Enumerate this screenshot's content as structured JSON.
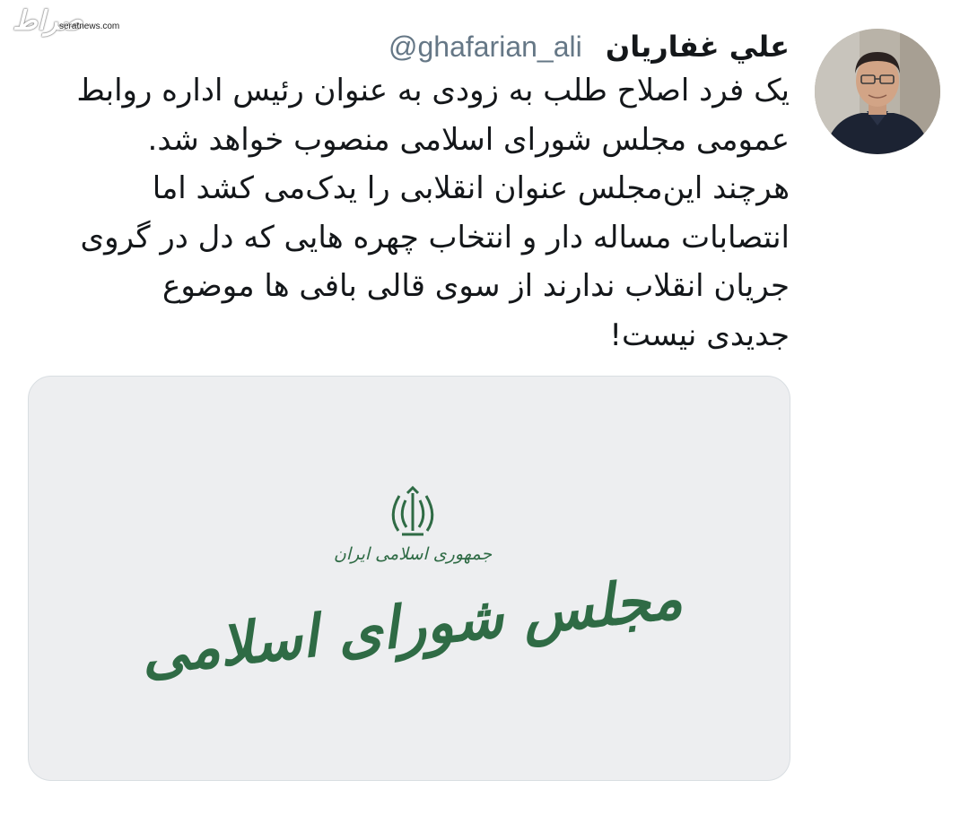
{
  "watermark": {
    "logo": "صراط",
    "site": "seratnews.com"
  },
  "tweet": {
    "author": {
      "display_name": "علي غفاريان",
      "handle": "@ghafarian_ali"
    },
    "text_lines": [
      "یک فرد اصلاح طلب به زودی به عنوان رئیس اداره روابط",
      "عمومی مجلس شورای اسلامی منصوب خواهد شد.",
      "هرچند این‌مجلس عنوان انقلابی را یدک‌می کشد اما",
      "انتصابات مساله دار و انتخاب چهره هایی که دل در گروی",
      "جریان انقلاب ندارند از سوی قالی بافی ها موضوع",
      "جدیدی نیست!"
    ],
    "media": {
      "subtitle": "جمهوری اسلامی ایران",
      "title": "مجلس شورای اسلامی"
    }
  },
  "colors": {
    "text": "#14171a",
    "secondary_text": "#657786",
    "card_background": "#edeef0",
    "card_border": "#d9dee2",
    "logo_green": "#2f6b45"
  },
  "icons": {
    "emblem": "iran-emblem-icon"
  }
}
